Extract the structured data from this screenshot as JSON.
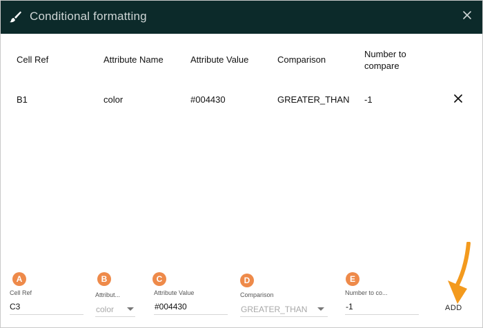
{
  "dialog": {
    "title": "Conditional formatting",
    "title_icon": "paintbrush-icon",
    "close_icon": "close-icon"
  },
  "table": {
    "headers": [
      "Cell Ref",
      "Attribute Name",
      "Attribute Value",
      "Comparison",
      "Number to compare"
    ],
    "rows": [
      [
        "B1",
        "color",
        "#004430",
        "GREATER_THAN",
        "-1"
      ]
    ],
    "delete_icon": "close-icon"
  },
  "form": {
    "cell_ref": {
      "label": "Cell Ref",
      "value": "C3"
    },
    "attribute": {
      "label": "Attribut...",
      "value": "color"
    },
    "attribute_value": {
      "label": "Attribute Value",
      "value": "#004430"
    },
    "comparison": {
      "label": "Comparison",
      "value": "GREATER_THAN"
    },
    "number": {
      "label": "Number to co...",
      "value": "-1"
    },
    "add_label": "ADD"
  },
  "annotations": {
    "badges": [
      "A",
      "B",
      "C",
      "D",
      "E"
    ],
    "badge_color": "#ee8a4a",
    "arrow_color": "#f39a1e"
  },
  "colors": {
    "titlebar": "#0c2a2a",
    "title_text": "#cfd6d6"
  }
}
